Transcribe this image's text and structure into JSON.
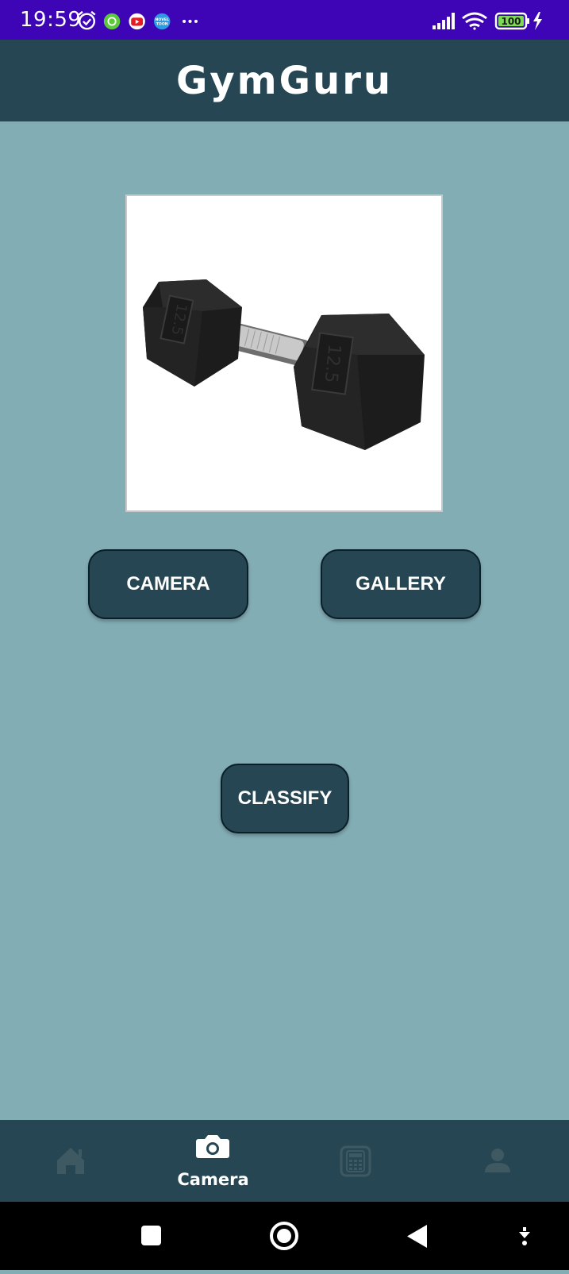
{
  "status_bar": {
    "time": "19:59",
    "battery": "100",
    "left_icons": [
      "alarm-icon",
      "chat-app-icon",
      "youtube-icon",
      "novel-toon-icon",
      "more-dots-icon"
    ],
    "right_icons": [
      "signal-icon",
      "wifi-icon",
      "battery-icon",
      "charging-icon"
    ]
  },
  "header": {
    "title": "GymGuru"
  },
  "image": {
    "label_left": "12.5",
    "label_right": "12.5"
  },
  "buttons": {
    "camera": "CAMERA",
    "gallery": "GALLERY",
    "classify": "CLASSIFY"
  },
  "bottom_nav": {
    "items": [
      {
        "icon": "home-icon",
        "label": "",
        "active": false
      },
      {
        "icon": "camera-icon",
        "label": "Camera",
        "active": true
      },
      {
        "icon": "calculator-icon",
        "label": "",
        "active": false
      },
      {
        "icon": "person-icon",
        "label": "",
        "active": false
      }
    ]
  },
  "system_nav": {
    "icons": [
      "recents-icon",
      "home-circle-icon",
      "back-icon",
      "keyboard-hide-icon"
    ]
  },
  "colors": {
    "status_bar": "#3d05b6",
    "header": "#264653",
    "background": "#83adb5",
    "button": "#264653",
    "nav_inactive": "#3f5963"
  }
}
